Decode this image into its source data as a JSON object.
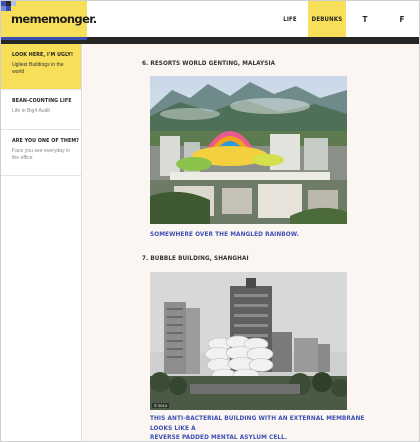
{
  "header": {
    "logo_text": "mememonger.",
    "nav": [
      {
        "label": "LIFE"
      },
      {
        "label": "DEBUNKS"
      },
      {
        "label": "T"
      },
      {
        "label": "F"
      }
    ]
  },
  "sidebar": {
    "items": [
      {
        "title": "LOOK HERE, I'M UGLY!",
        "desc": "Ugliest Buildings in the world"
      },
      {
        "title": "BEAN-COUNTING LIFE",
        "desc": "Life in Big4 Audit"
      },
      {
        "title": "ARE YOU ONE OF THEM?",
        "desc": "Face you see everyday in the office"
      }
    ]
  },
  "main": {
    "entries": [
      {
        "heading": "6.  RESORTS WORLD GENTING, MALAYSIA",
        "caption": "SOMEWHERE OVER THE MANGLED RAINBOW."
      },
      {
        "heading": "7.  BUBBLE BUILDING, SHANGHAI",
        "caption_line1": "THIS ANTI-BACTERIAL BUILDING WITH AN EXTERNAL MEMBRANE LOOKS LIKE A",
        "caption_line2": "REVERSE PADDED MENTAL ASYLUM CELL.",
        "credit": "© 2014"
      }
    ]
  },
  "colors": {
    "brand_yellow": "#f8df5a",
    "accent_blue": "#3a4fb6",
    "dark_bar": "#262626",
    "main_bg": "#fbf6f1"
  }
}
